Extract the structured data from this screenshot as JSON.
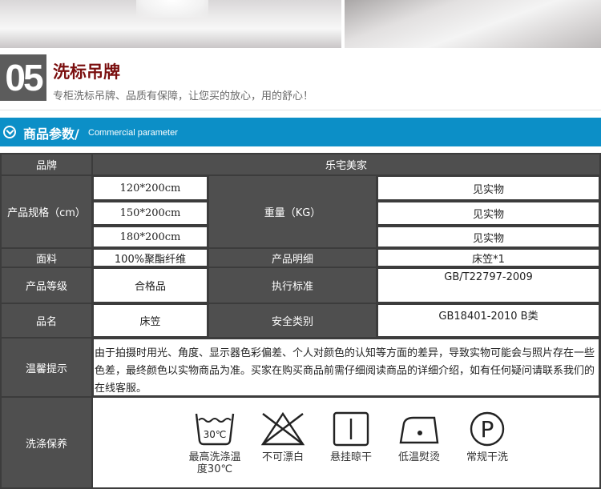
{
  "section": {
    "number": "05",
    "title": "洗标吊牌",
    "subtitle": "专柜洗标吊牌、品质有保障，让您买的放心，用的舒心！"
  },
  "param_bar": {
    "title": "商品参数/",
    "title_en": "Commercial parameter"
  },
  "table": {
    "brand_label": "品牌",
    "brand_value": "乐宅美家",
    "size_label": "产品规格（cm）",
    "sizes": [
      "120*200cm",
      "150*200cm",
      "180*200cm"
    ],
    "weight_label": "重量（KG）",
    "weights": [
      "见实物",
      "见实物",
      "见实物"
    ],
    "fabric_label": "面料",
    "fabric_value": "100%聚酯纤维",
    "detail_label": "产品明细",
    "detail_value": "床笠*1",
    "grade_label": "产品等级",
    "grade_value": "合格品",
    "standard_label": "执行标准",
    "standard_value": "GB/T22797-2009",
    "name_label": "品名",
    "name_value": "床笠",
    "safety_label": "安全类别",
    "safety_value": "GB18401-2010 B类",
    "tip_label": "温馨提示",
    "tip_value": "由于拍摄时用光、角度、显示器色彩偏差、个人对颜色的认知等方面的差异，导致实物可能会与照片存在一些色差，最终颜色以实物商品为准。买家在购买商品前需仔细阅读商品的详细介绍，如有任何疑问请联系我们的在线客服。",
    "care_label": "洗涤保养"
  },
  "care": {
    "wash_temp": "30℃",
    "dryclean_letter": "P",
    "items": [
      {
        "icon": "wash-30-icon",
        "label": "最高洗涤温度30℃"
      },
      {
        "icon": "no-bleach-icon",
        "label": "不可漂白"
      },
      {
        "icon": "hang-dry-icon",
        "label": "悬挂晾干"
      },
      {
        "icon": "low-iron-icon",
        "label": "低温熨烫"
      },
      {
        "icon": "dry-clean-icon",
        "label": "常规干洗"
      }
    ]
  },
  "colors": {
    "accent_blue": "#0c8fc7",
    "title_red": "#7b0f0f",
    "label_gray": "#4f4f4f"
  }
}
